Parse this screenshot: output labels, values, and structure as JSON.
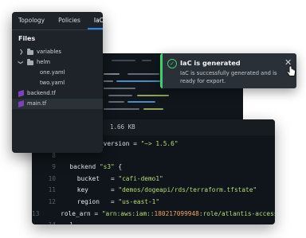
{
  "tabs": [
    "Topology",
    "Policies",
    "IaC"
  ],
  "active_tab": "IaC",
  "files_title": "Files",
  "tree": [
    {
      "label": "variables",
      "type": "folder",
      "expanded": false
    },
    {
      "label": "helm",
      "type": "folder",
      "expanded": true
    },
    {
      "label": "one.yaml",
      "type": "file"
    },
    {
      "label": "two.yaml",
      "type": "file"
    },
    {
      "label": "backend.tf",
      "type": "terraform"
    },
    {
      "label": "main.tf",
      "type": "terraform",
      "selected": true
    }
  ],
  "code_header": "1.66 KB",
  "code_lines": [
    {
      "n": "",
      "tokens": [
        [
          "plain",
          "  required_version = "
        ],
        [
          "str",
          "\"~> 1.5.6\""
        ]
      ]
    },
    {
      "n": "8",
      "tokens": []
    },
    {
      "n": "9",
      "tokens": [
        [
          "plain",
          "  backend "
        ],
        [
          "str",
          "\"s3\""
        ],
        [
          "plain",
          " {"
        ]
      ]
    },
    {
      "n": "10",
      "tokens": [
        [
          "plain",
          "    bucket   = "
        ],
        [
          "str",
          "\"cafi-demo1\""
        ]
      ]
    },
    {
      "n": "11",
      "tokens": [
        [
          "plain",
          "    key      = "
        ],
        [
          "str",
          "\"demos/dogeapi/rds/terraform.tfstate\""
        ]
      ]
    },
    {
      "n": "12",
      "tokens": [
        [
          "plain",
          "    region   = "
        ],
        [
          "str",
          "\"us-east-1\""
        ]
      ]
    },
    {
      "n": "13",
      "tokens": [
        [
          "plain",
          "    role_arn = "
        ],
        [
          "str",
          "\"arn:aws:iam::"
        ],
        [
          "num",
          "180217099948"
        ],
        [
          "str",
          ":role/atlantis-access\""
        ]
      ]
    },
    {
      "n": "14",
      "tokens": [
        [
          "plain",
          "  }"
        ]
      ]
    },
    {
      "n": "",
      "tokens": []
    }
  ],
  "toast": {
    "title": "IaC is generated",
    "message": "IaC is successfully generated and is ready for export.",
    "accent_color": "#3ecf6e"
  },
  "icons": {
    "success": "check-circle-icon",
    "close": "close-icon",
    "folder": "folder-icon",
    "terraform": "terraform-icon"
  }
}
